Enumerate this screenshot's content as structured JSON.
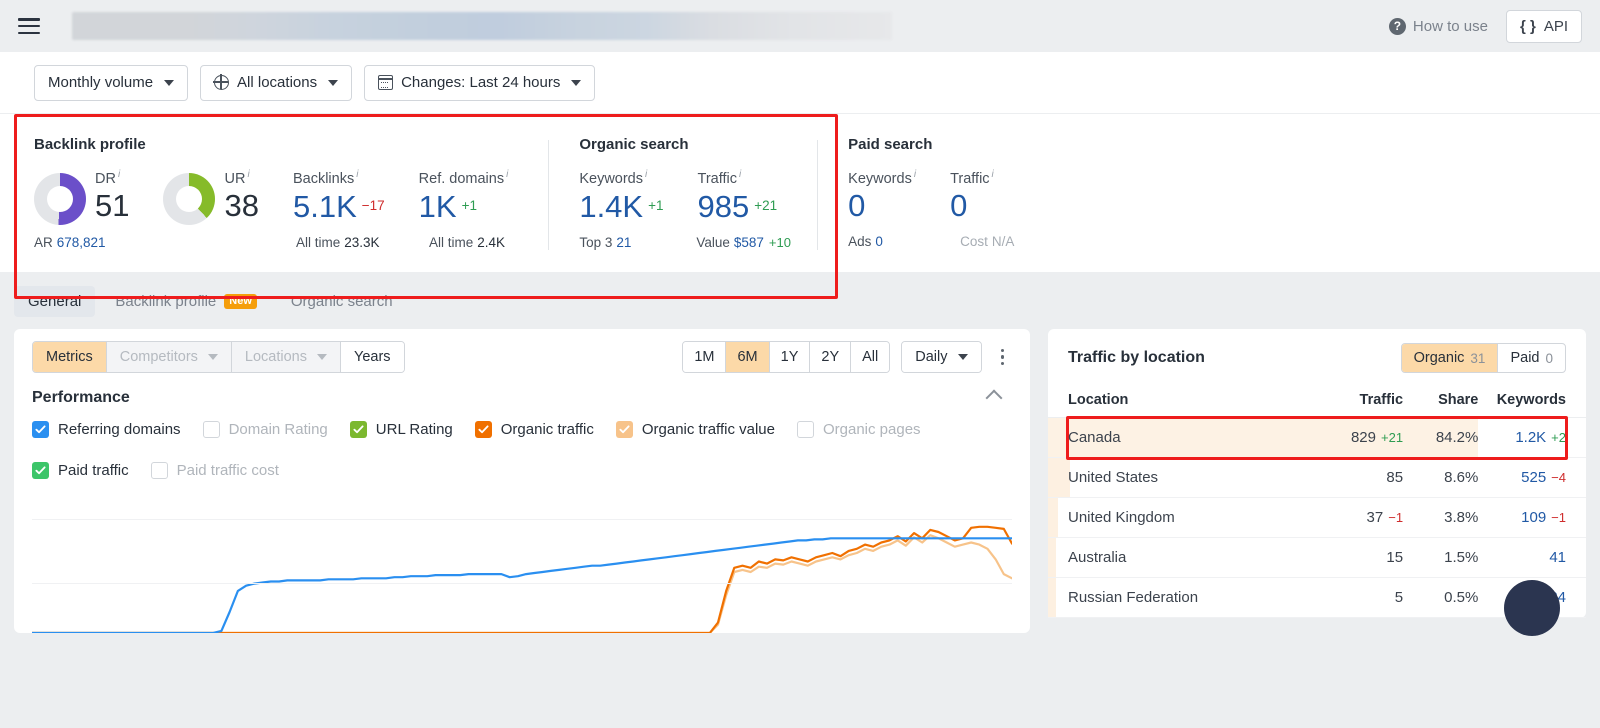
{
  "topbar": {
    "how_to_use": "How to use",
    "api_label": "API",
    "api_icon": "{ }",
    "menu_icon": "hamburger-icon",
    "help_icon": "question-mark-icon"
  },
  "filters": [
    {
      "label": "Monthly volume",
      "icon": null
    },
    {
      "label": "All locations",
      "icon": "globe-icon"
    },
    {
      "label": "Changes: Last 24 hours",
      "icon": "calendar-icon"
    }
  ],
  "overview": {
    "backlink": {
      "title": "Backlink profile",
      "dr": {
        "label": "DR",
        "value": "51",
        "pct": 51,
        "color": "#6b4fc9"
      },
      "ur": {
        "label": "UR",
        "value": "38",
        "pct": 38,
        "color": "#86bb2a"
      },
      "ar": {
        "label": "AR",
        "value": "678,821"
      },
      "backlinks": {
        "label": "Backlinks",
        "value": "5.1K",
        "delta": "−17",
        "delta_dir": "down",
        "sub_label": "All time",
        "sub_value": "23.3K"
      },
      "ref_domains": {
        "label": "Ref. domains",
        "value": "1K",
        "delta": "+1",
        "delta_dir": "up",
        "sub_label": "All time",
        "sub_value": "2.4K"
      }
    },
    "organic": {
      "title": "Organic search",
      "keywords": {
        "label": "Keywords",
        "value": "1.4K",
        "delta": "+1",
        "delta_dir": "up",
        "sub_label": "Top 3",
        "sub_value": "21"
      },
      "traffic": {
        "label": "Traffic",
        "value": "985",
        "delta": "+21",
        "delta_dir": "up",
        "sub_label": "Value",
        "sub_value": "$587",
        "sub_delta": "+10"
      }
    },
    "paid": {
      "title": "Paid search",
      "keywords": {
        "label": "Keywords",
        "value": "0",
        "sub_label": "Ads",
        "sub_value": "0"
      },
      "traffic": {
        "label": "Traffic",
        "value": "0",
        "sub_label": "Cost",
        "sub_value": "N/A"
      }
    }
  },
  "tabs": [
    {
      "label": "General",
      "active": true,
      "badge": null
    },
    {
      "label": "Backlink profile",
      "active": false,
      "badge": "New"
    },
    {
      "label": "Organic search",
      "active": false,
      "badge": null
    }
  ],
  "chart_panel": {
    "seg_left": [
      {
        "label": "Metrics",
        "state": "on"
      },
      {
        "label": "Competitors",
        "state": "disabled",
        "caret": true
      },
      {
        "label": "Locations",
        "state": "disabled",
        "caret": true
      },
      {
        "label": "Years",
        "state": "normal"
      }
    ],
    "ranges": [
      {
        "label": "1M",
        "state": "normal"
      },
      {
        "label": "6M",
        "state": "on"
      },
      {
        "label": "1Y",
        "state": "normal"
      },
      {
        "label": "2Y",
        "state": "normal"
      },
      {
        "label": "All",
        "state": "normal"
      }
    ],
    "granularity": "Daily",
    "section_title": "Performance",
    "legend": [
      {
        "label": "Referring domains",
        "checked": true,
        "color": "#2a8ff0"
      },
      {
        "label": "Domain Rating",
        "checked": false,
        "color": null
      },
      {
        "label": "URL Rating",
        "checked": true,
        "color": "#7cb82f"
      },
      {
        "label": "Organic traffic",
        "checked": true,
        "color": "#f07000"
      },
      {
        "label": "Organic traffic value",
        "checked": true,
        "color": "#f7c38a"
      },
      {
        "label": "Organic pages",
        "checked": false,
        "color": null
      },
      {
        "label": "Paid traffic",
        "checked": true,
        "color": "#3cc569"
      },
      {
        "label": "Paid traffic cost",
        "checked": false,
        "color": null
      }
    ]
  },
  "chart_data": {
    "type": "line",
    "title": "Performance",
    "xlabel": "",
    "ylabel": "",
    "grid": true,
    "legend_position": "top",
    "series": [
      {
        "name": "Referring domains",
        "color": "#2a8ff0",
        "values": [
          0,
          0,
          0,
          0,
          0,
          0,
          0,
          0,
          0,
          0,
          0,
          0,
          0,
          0,
          0,
          0,
          0,
          0,
          0,
          0,
          0,
          0,
          0,
          2,
          20,
          40,
          45,
          47,
          48,
          49,
          49,
          50,
          50,
          50,
          50,
          50,
          51,
          51,
          51,
          51,
          52,
          52,
          52,
          52,
          53,
          53,
          54,
          54,
          54,
          55,
          55,
          55,
          55,
          56,
          56,
          56,
          56,
          56,
          53,
          54,
          56,
          57,
          58,
          59,
          60,
          61,
          62,
          63,
          64,
          64,
          65,
          66,
          67,
          68,
          69,
          70,
          71,
          72,
          73,
          74,
          75,
          76,
          77,
          78,
          79,
          80,
          81,
          82,
          83,
          84,
          85,
          86,
          87,
          88,
          88,
          89,
          89,
          90,
          90,
          90,
          90,
          90,
          90,
          90,
          90,
          90,
          90,
          90,
          90,
          90,
          90,
          90,
          90,
          90,
          90,
          90,
          90,
          90,
          90,
          90
        ]
      },
      {
        "name": "Organic traffic",
        "color": "#f07000",
        "values": [
          0,
          0,
          0,
          0,
          0,
          0,
          0,
          0,
          0,
          0,
          0,
          0,
          0,
          0,
          0,
          0,
          0,
          0,
          0,
          0,
          0,
          0,
          0,
          0,
          0,
          0,
          0,
          0,
          0,
          0,
          0,
          0,
          0,
          0,
          0,
          0,
          0,
          0,
          0,
          0,
          0,
          0,
          0,
          0,
          0,
          0,
          0,
          0,
          0,
          0,
          0,
          0,
          0,
          0,
          0,
          0,
          0,
          0,
          0,
          0,
          0,
          0,
          0,
          0,
          0,
          0,
          0,
          0,
          0,
          0,
          0,
          0,
          0,
          0,
          0,
          0,
          0,
          0,
          0,
          0,
          0,
          0,
          0,
          0,
          10,
          40,
          62,
          64,
          62,
          68,
          66,
          70,
          69,
          72,
          70,
          68,
          72,
          74,
          76,
          73,
          78,
          80,
          84,
          82,
          86,
          88,
          92,
          87,
          95,
          90,
          98,
          96,
          92,
          88,
          90,
          100,
          101,
          101,
          100,
          99,
          85
        ]
      },
      {
        "name": "Organic traffic value",
        "color": "#f7c38a",
        "values": [
          0,
          0,
          0,
          0,
          0,
          0,
          0,
          0,
          0,
          0,
          0,
          0,
          0,
          0,
          0,
          0,
          0,
          0,
          0,
          0,
          0,
          0,
          0,
          0,
          0,
          0,
          0,
          0,
          0,
          0,
          0,
          0,
          0,
          0,
          0,
          0,
          0,
          0,
          0,
          0,
          0,
          0,
          0,
          0,
          0,
          0,
          0,
          0,
          0,
          0,
          0,
          0,
          0,
          0,
          0,
          0,
          0,
          0,
          0,
          0,
          0,
          0,
          0,
          0,
          0,
          0,
          0,
          0,
          0,
          0,
          0,
          0,
          0,
          0,
          0,
          0,
          0,
          0,
          0,
          0,
          0,
          0,
          0,
          0,
          8,
          36,
          58,
          60,
          58,
          63,
          62,
          66,
          65,
          68,
          66,
          64,
          68,
          70,
          72,
          70,
          74,
          76,
          80,
          78,
          82,
          84,
          88,
          83,
          91,
          86,
          93,
          90,
          86,
          82,
          84,
          86,
          84,
          80,
          70,
          56,
          52
        ]
      }
    ]
  },
  "traffic_panel": {
    "title": "Traffic by location",
    "toggle": [
      {
        "label": "Organic",
        "count": "31",
        "active": true
      },
      {
        "label": "Paid",
        "count": "0",
        "active": false
      }
    ],
    "columns": [
      "Location",
      "Traffic",
      "Share",
      "Keywords"
    ],
    "rows": [
      {
        "location": "Canada",
        "traffic": "829",
        "traffic_delta": "+21",
        "traffic_dir": "up",
        "share": "84.2%",
        "share_pct": 84.2,
        "keywords": "1.2K",
        "kw_delta": "+2",
        "kw_dir": "up",
        "highlight": true
      },
      {
        "location": "United States",
        "traffic": "85",
        "traffic_delta": null,
        "traffic_dir": null,
        "share": "8.6%",
        "share_pct": 8.6,
        "keywords": "525",
        "kw_delta": "−4",
        "kw_dir": "down",
        "highlight": false
      },
      {
        "location": "United Kingdom",
        "traffic": "37",
        "traffic_delta": "−1",
        "traffic_dir": "down",
        "share": "3.8%",
        "share_pct": 3.8,
        "keywords": "109",
        "kw_delta": "−1",
        "kw_dir": "down",
        "highlight": false
      },
      {
        "location": "Australia",
        "traffic": "15",
        "traffic_delta": null,
        "traffic_dir": null,
        "share": "1.5%",
        "share_pct": 1.5,
        "keywords": "41",
        "kw_delta": null,
        "kw_dir": null,
        "highlight": false
      },
      {
        "location": "Russian Federation",
        "traffic": "5",
        "traffic_delta": null,
        "traffic_dir": null,
        "share": "0.5%",
        "share_pct": 0.5,
        "keywords": "24",
        "kw_delta": null,
        "kw_dir": null,
        "highlight": false
      }
    ]
  },
  "annotations": {
    "highlight_color": "#ee1c1c",
    "boxes": [
      "overview-metrics",
      "canada-row"
    ]
  }
}
